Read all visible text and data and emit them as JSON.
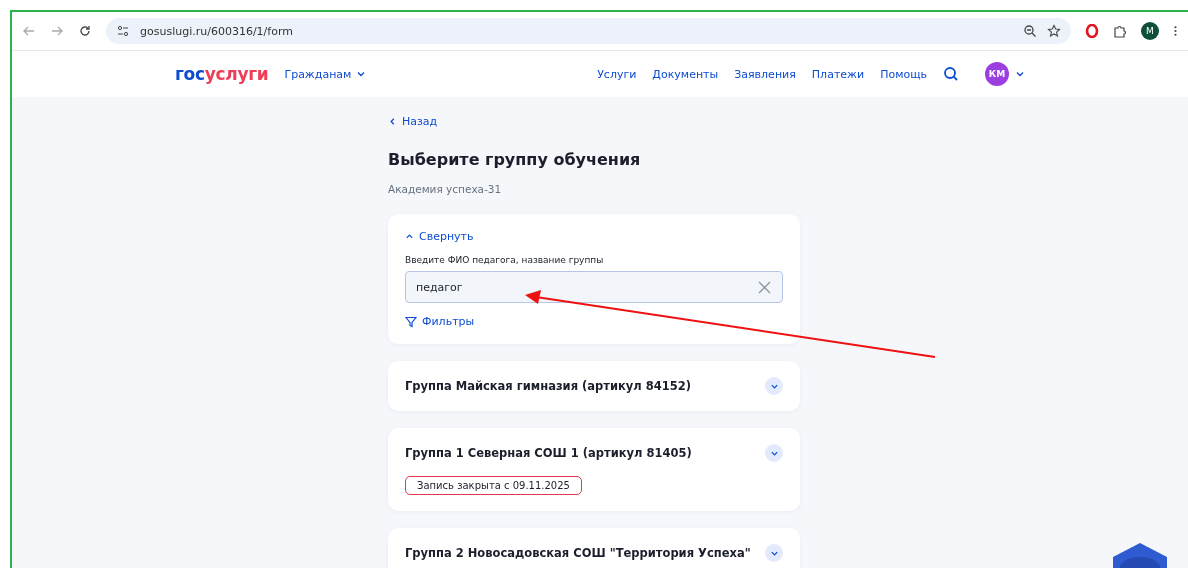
{
  "browser": {
    "url": "gosuslugi.ru/600316/1/form",
    "profile": "M"
  },
  "header": {
    "logo": [
      "гос",
      "услуги"
    ],
    "audience": "Гражданам",
    "nav": [
      "Услуги",
      "Документы",
      "Заявления",
      "Платежи",
      "Помощь"
    ],
    "avatar": "КМ"
  },
  "back": "Назад",
  "title": "Выберите группу обучения",
  "subtitle": "Академия успеха-31",
  "search_panel": {
    "toggle": "Свернуть",
    "expanded": true,
    "label": "Введите ФИО педагога, название группы",
    "value": "педагог",
    "filters": "Фильтры"
  },
  "groups": [
    {
      "title": "Группа Майская гимназия (артикул 84152)"
    },
    {
      "title": "Группа 1 Северная СОШ 1 (артикул 81405)",
      "badge": "Запись закрыта с 09.11.2025"
    },
    {
      "title": "Группа 2 Новосадовская СОШ \"Территория Успеха\""
    }
  ]
}
